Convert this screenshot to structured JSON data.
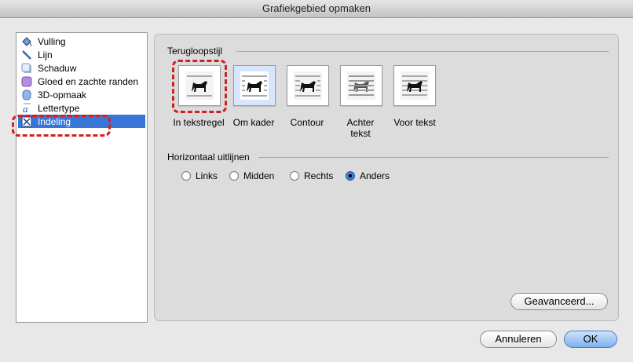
{
  "window": {
    "title": "Grafiekgebied opmaken"
  },
  "sidebar": {
    "items": [
      {
        "label": "Vulling",
        "icon": "fill-bucket-icon"
      },
      {
        "label": "Lijn",
        "icon": "line-icon"
      },
      {
        "label": "Schaduw",
        "icon": "shadow-icon"
      },
      {
        "label": "Gloed en zachte randen",
        "icon": "glow-icon"
      },
      {
        "label": "3D-opmaak",
        "icon": "3d-format-icon"
      },
      {
        "label": "Lettertype",
        "icon": "font-icon"
      },
      {
        "label": "Indeling",
        "icon": "layout-icon",
        "selected": true
      }
    ]
  },
  "wrap": {
    "title": "Terugloopstijl",
    "options": [
      {
        "label": "In tekstregel",
        "selected": false
      },
      {
        "label": "Om kader",
        "selected": true
      },
      {
        "label": "Contour",
        "selected": false
      },
      {
        "label": "Achter tekst",
        "selected": false
      },
      {
        "label": "Voor tekst",
        "selected": false
      }
    ]
  },
  "align": {
    "title": "Horizontaal uitlijnen",
    "options": [
      {
        "label": "Links",
        "checked": false
      },
      {
        "label": "Midden",
        "checked": false
      },
      {
        "label": "Rechts",
        "checked": false
      },
      {
        "label": "Anders",
        "checked": true
      }
    ]
  },
  "buttons": {
    "advanced": "Geavanceerd...",
    "cancel": "Annuleren",
    "ok": "OK"
  },
  "colors": {
    "selection": "#3875d7",
    "highlight": "#d02020"
  }
}
